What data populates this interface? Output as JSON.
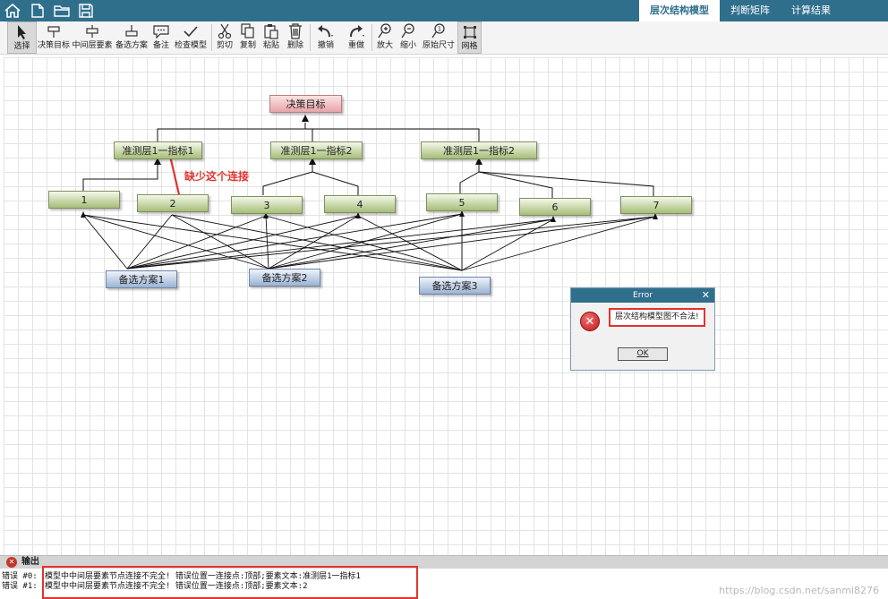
{
  "quick_access": [
    {
      "name": "home-icon"
    },
    {
      "name": "new-file-icon"
    },
    {
      "name": "open-folder-icon"
    },
    {
      "name": "save-icon"
    }
  ],
  "tabs": [
    {
      "label": "层次结构模型",
      "active": true
    },
    {
      "label": "判断矩阵",
      "active": false
    },
    {
      "label": "计算结果",
      "active": false
    }
  ],
  "toolbar": [
    {
      "label": "选择",
      "icon": "pointer-icon",
      "selected": true
    },
    {
      "label": "决策目标",
      "icon": "goal-node-icon"
    },
    {
      "label": "中间层要素",
      "icon": "middle-node-icon"
    },
    {
      "label": "备选方案",
      "icon": "alternative-node-icon"
    },
    {
      "label": "备注",
      "icon": "comment-icon"
    },
    {
      "label": "检查模型",
      "icon": "checkmark-icon"
    },
    {
      "label": "剪切",
      "icon": "scissors-icon"
    },
    {
      "label": "复制",
      "icon": "copy-icon"
    },
    {
      "label": "粘贴",
      "icon": "paste-icon"
    },
    {
      "label": "删除",
      "icon": "trash-icon"
    },
    {
      "label": "撤销",
      "icon": "undo-icon"
    },
    {
      "label": "重做",
      "icon": "redo-icon"
    },
    {
      "label": "放大",
      "icon": "zoom-in-icon"
    },
    {
      "label": "缩小",
      "icon": "zoom-out-icon"
    },
    {
      "label": "原始尺寸",
      "icon": "actual-size-icon"
    },
    {
      "label": "网格",
      "icon": "grid-icon",
      "selected": true
    }
  ],
  "diagram": {
    "goal": "决策目标",
    "criteria": [
      "准测层1一指标1",
      "准测层1一指标2",
      "准测层1一指标2"
    ],
    "indicators": [
      "1",
      "2",
      "3",
      "4",
      "5",
      "6",
      "7"
    ],
    "alternatives": [
      "备选方案1",
      "备选方案2",
      "备选方案3"
    ],
    "annotation": "缺少这个连接",
    "colors": {
      "annotation": "#e0342f",
      "header": "#2f6f8c"
    }
  },
  "dialog": {
    "title": "Error",
    "close": "✕",
    "icon": "error-icon",
    "message": "层次结构模型图不合法!",
    "ok": "OK"
  },
  "output": {
    "title": "输出",
    "rows": [
      {
        "prefix": "错误 #0:",
        "text": "模型中中间层要素节点连接不完全!  错误位置一连接点:顶部;要素文本:准测层1一指标1"
      },
      {
        "prefix": "错误 #1:",
        "text": "模型中中间层要素节点连接不完全!  错误位置一连接点:顶部;要素文本:2"
      }
    ]
  },
  "watermark": "https://blog.csdn.net/sanmi8276"
}
